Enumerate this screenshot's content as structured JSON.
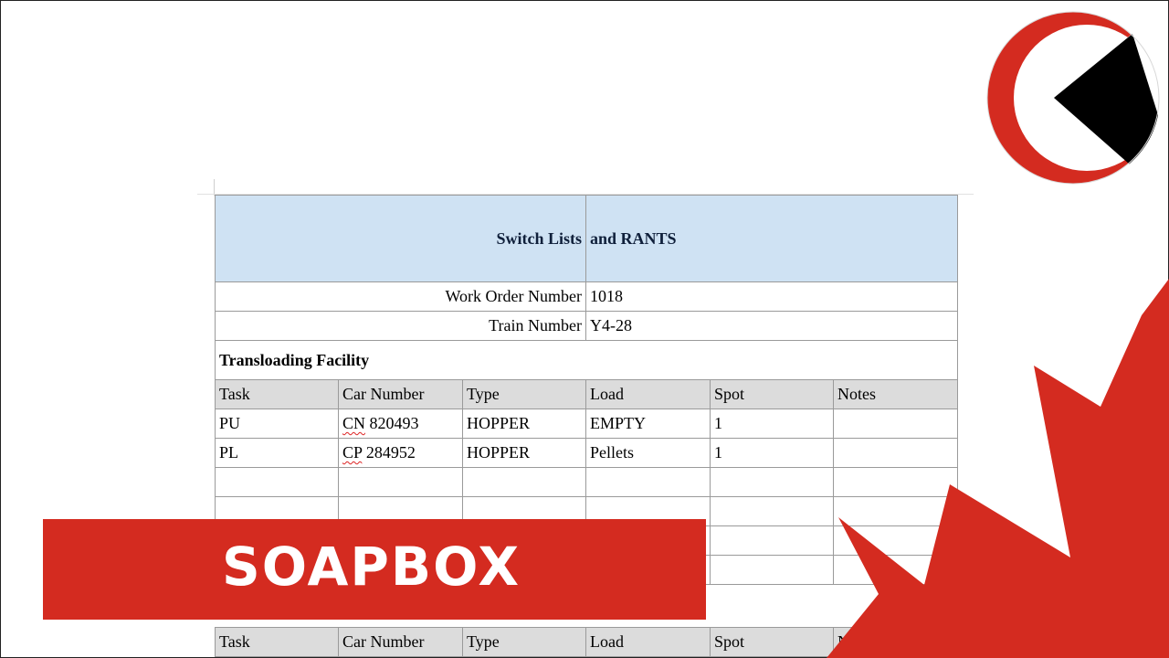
{
  "title": {
    "left": "Switch Lists",
    "right": "and RANTS"
  },
  "work_order": {
    "label": "Work Order Number",
    "value": "1018"
  },
  "train": {
    "label": "Train Number",
    "value": "Y4-28"
  },
  "section": {
    "title": "Transloading Facility"
  },
  "columns": [
    "Task",
    "Car Number",
    "Type",
    "Load",
    "Spot",
    "Notes"
  ],
  "rows": [
    {
      "task": "PU",
      "car_prefix": "CN",
      "car_num": " 820493",
      "type": "HOPPER",
      "load": "EMPTY",
      "spot": "1",
      "notes": ""
    },
    {
      "task": "PL",
      "car_prefix": "CP",
      "car_num": " 284952",
      "type": "HOPPER",
      "load": "Pellets",
      "spot": "1",
      "notes": ""
    }
  ],
  "columns2": [
    "Task",
    "Car Number",
    "Type",
    "Load",
    "Spot",
    "Notes"
  ],
  "banner": {
    "text": "SOAPBOX"
  },
  "colors": {
    "banner": "#d42b20",
    "title_bg": "#cfe2f3",
    "title_text": "#0f1f3a",
    "header_bg": "#dcdcdc"
  },
  "icons": {
    "logo": "play-logo-icon",
    "leaf": "maple-leaf-icon"
  }
}
